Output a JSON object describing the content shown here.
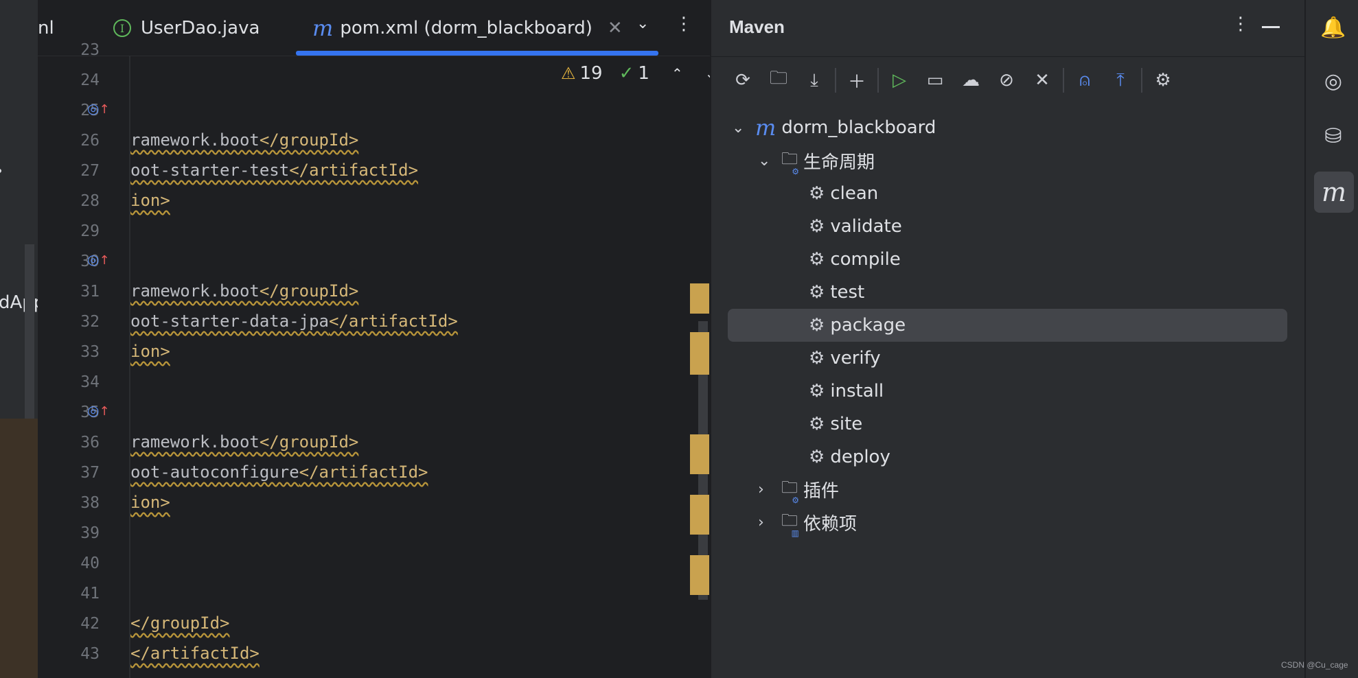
{
  "left_panel": {
    "visible_text": "dApp"
  },
  "tabs": [
    {
      "label": "nl"
    },
    {
      "label": "UserDao.java",
      "icon": "interface-icon"
    },
    {
      "label": "pom.xml (dorm_blackboard)",
      "icon": "maven-icon",
      "active": true
    }
  ],
  "inspections": {
    "warnings": "19",
    "checks": "1"
  },
  "editor": {
    "lines": [
      {
        "num": "23",
        "code": ""
      },
      {
        "num": "24",
        "code": ""
      },
      {
        "num": "25",
        "code": "",
        "gutter_icon": true
      },
      {
        "num": "26",
        "pre": "ramework.boot",
        "tag": "</groupId>"
      },
      {
        "num": "27",
        "pre": "oot-starter-test",
        "tag": "</artifactId>"
      },
      {
        "num": "28",
        "tag": "ion>"
      },
      {
        "num": "29",
        "code": ""
      },
      {
        "num": "30",
        "code": "",
        "gutter_icon": true
      },
      {
        "num": "31",
        "pre": "ramework.boot",
        "tag": "</groupId>"
      },
      {
        "num": "32",
        "pre": "oot-starter-data-jpa",
        "tag": "</artifactId>"
      },
      {
        "num": "33",
        "tag": "ion>"
      },
      {
        "num": "34",
        "code": ""
      },
      {
        "num": "35",
        "code": "",
        "gutter_icon": true
      },
      {
        "num": "36",
        "pre": "ramework.boot",
        "tag": "</groupId>"
      },
      {
        "num": "37",
        "pre": "oot-autoconfigure",
        "tag": "</artifactId>"
      },
      {
        "num": "38",
        "tag": "ion>"
      },
      {
        "num": "39",
        "code": ""
      },
      {
        "num": "40",
        "code": ""
      },
      {
        "num": "41",
        "code": ""
      },
      {
        "num": "42",
        "tag": "</groupId>"
      },
      {
        "num": "43",
        "tag": "</artifactId>"
      }
    ]
  },
  "maven": {
    "title": "Maven",
    "project": "dorm_blackboard",
    "lifecycle_label": "生命周期",
    "goals": [
      "clean",
      "validate",
      "compile",
      "test",
      "package",
      "verify",
      "install",
      "site",
      "deploy"
    ],
    "selected_goal": "package",
    "plugins_label": "插件",
    "dependencies_label": "依赖项"
  },
  "watermark": "CSDN @Cu_cage",
  "colors": {
    "accent": "#3574f0",
    "tag": "#d5b778",
    "warning": "#e6b53e",
    "success": "#5fb85b"
  }
}
